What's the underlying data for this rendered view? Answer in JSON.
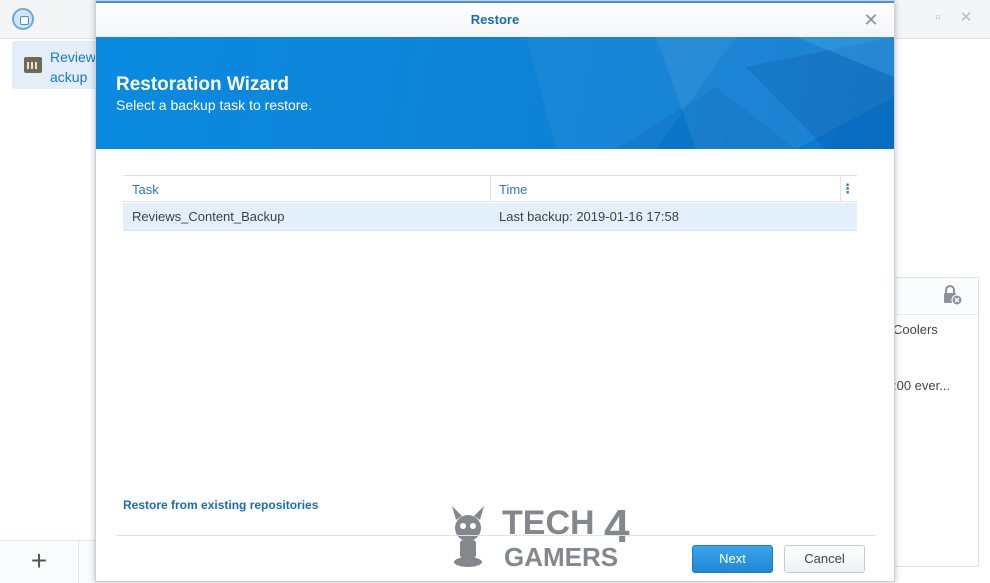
{
  "app": {
    "sidebar": {
      "item_label": "Review\nackup"
    },
    "right_panel": {
      "line1": "Coolers",
      "line2": ":00 ever..."
    },
    "add_label": "+"
  },
  "modal": {
    "title": "Restore",
    "close_label": "✕",
    "banner": {
      "title": "Restoration Wizard",
      "subtitle": "Select a backup task to restore."
    },
    "grid": {
      "columns": [
        "Task",
        "Time"
      ],
      "column_menu_label": "⋮",
      "rows": [
        {
          "task": "Reviews_Content_Backup",
          "time": "Last backup: 2019-01-16 17:58"
        }
      ]
    },
    "restore_link": "Restore from existing repositories",
    "buttons": {
      "next": "Next",
      "cancel": "Cancel"
    }
  },
  "watermark": {
    "text_top": "TECH",
    "text_num": "4",
    "text_bottom": "GAMERS"
  },
  "colors": {
    "accent": "#1a78c2",
    "banner": "#0a8be0",
    "selected_row": "#e3f0fb"
  }
}
